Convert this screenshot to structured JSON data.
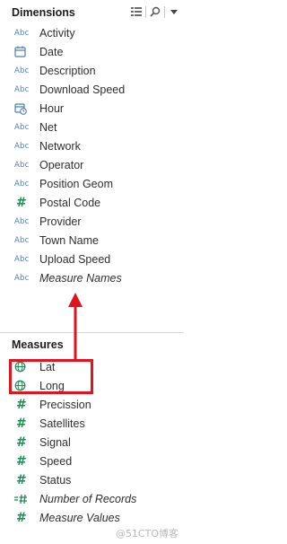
{
  "dimensions": {
    "title": "Dimensions",
    "fields": [
      {
        "label": "Activity",
        "icon": "abc-string-icon"
      },
      {
        "label": "Date",
        "icon": "calendar-date-icon"
      },
      {
        "label": "Description",
        "icon": "abc-string-icon"
      },
      {
        "label": "Download Speed",
        "icon": "abc-string-icon"
      },
      {
        "label": "Hour",
        "icon": "datetime-clock-icon"
      },
      {
        "label": "Net",
        "icon": "abc-string-icon"
      },
      {
        "label": "Network",
        "icon": "abc-string-icon"
      },
      {
        "label": "Operator",
        "icon": "abc-string-icon"
      },
      {
        "label": "Position Geom",
        "icon": "abc-string-icon"
      },
      {
        "label": "Postal Code",
        "icon": "hash-number-icon"
      },
      {
        "label": "Provider",
        "icon": "abc-string-icon"
      },
      {
        "label": "Town Name",
        "icon": "abc-string-icon"
      },
      {
        "label": "Upload Speed",
        "icon": "abc-string-icon"
      },
      {
        "label": "Measure Names",
        "icon": "abc-string-icon"
      }
    ]
  },
  "measures": {
    "title": "Measures",
    "fields": [
      {
        "label": "Lat",
        "icon": "globe-geo-icon"
      },
      {
        "label": "Long",
        "icon": "globe-geo-icon"
      },
      {
        "label": "Precission",
        "icon": "hash-number-icon"
      },
      {
        "label": "Satellites",
        "icon": "hash-number-icon"
      },
      {
        "label": "Signal",
        "icon": "hash-number-icon"
      },
      {
        "label": "Speed",
        "icon": "hash-number-icon"
      },
      {
        "label": "Status",
        "icon": "hash-number-icon"
      },
      {
        "label": "Number of Records",
        "icon": "number-of-records-icon"
      },
      {
        "label": "Measure Values",
        "icon": "hash-number-icon"
      }
    ]
  },
  "header_icons": [
    "list-view-icon",
    "search-icon",
    "dropdown-menu-icon"
  ],
  "abc_text": "Abc",
  "hash_text": "#",
  "watermark": "@51CTO博客",
  "colors": {
    "string_icon": "#4a7fb5",
    "number_icon": "#1b8f54",
    "annotation": "#e0131f"
  }
}
